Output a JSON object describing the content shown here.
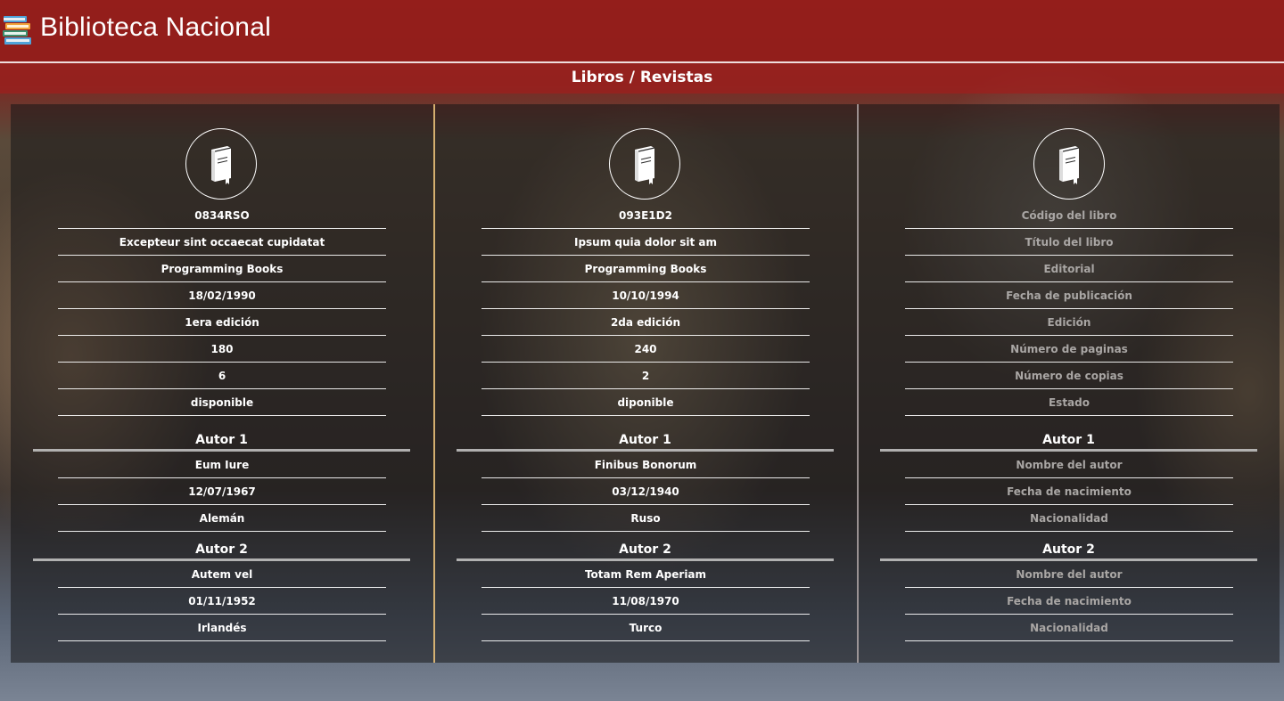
{
  "app": {
    "title": "Biblioteca Nacional",
    "logo_icon": "stacked-books-icon"
  },
  "section": {
    "title": "Libros / Revistas"
  },
  "columns": [
    {
      "icon": "book-icon",
      "fields": [
        "0834RSO",
        "Excepteur sint occaecat cupidatat",
        "Programming Books",
        "18/02/1990",
        "1era edición",
        "180",
        "6",
        "disponible"
      ],
      "authors": [
        {
          "heading": "Autor 1",
          "fields": [
            "Eum Iure",
            "12/07/1967",
            "Alemán"
          ]
        },
        {
          "heading": "Autor 2",
          "fields": [
            "Autem vel",
            "01/11/1952",
            "Irlandés"
          ]
        }
      ]
    },
    {
      "icon": "book-icon",
      "fields": [
        "093E1D2",
        "Ipsum quia dolor sit am",
        "Programming Books",
        "10/10/1994",
        "2da edición",
        "240",
        "2",
        "diponible"
      ],
      "authors": [
        {
          "heading": "Autor 1",
          "fields": [
            "Finibus Bonorum",
            "03/12/1940",
            "Ruso"
          ]
        },
        {
          "heading": "Autor 2",
          "fields": [
            "Totam Rem Aperiam",
            "11/08/1970",
            "Turco"
          ]
        }
      ]
    },
    {
      "icon": "book-icon",
      "fields": [
        "Código del libro",
        "Título del libro",
        "Editorial",
        "Fecha de publicación",
        "Edición",
        "Número de paginas",
        "Número de copias",
        "Estado"
      ],
      "authors": [
        {
          "heading": "Autor 1",
          "fields": [
            "Nombre del autor",
            "Fecha de nacimiento",
            "Nacionalidad"
          ]
        },
        {
          "heading": "Autor 2",
          "fields": [
            "Nombre del autor",
            "Fecha de nacimiento",
            "Nacionalidad"
          ]
        }
      ]
    }
  ],
  "colors": {
    "header_bg": "#961c1a",
    "placeholder_text": "#a9a6a4",
    "divider_gold": "#e6be78"
  }
}
